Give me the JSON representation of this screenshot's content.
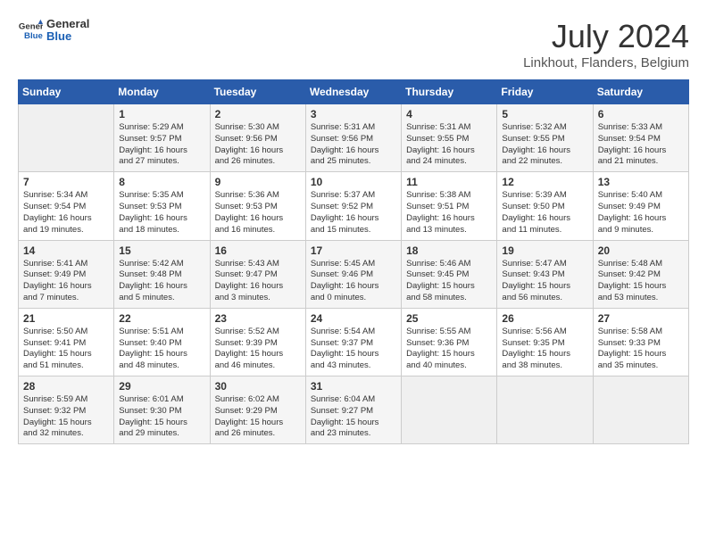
{
  "app": {
    "name_line1": "General",
    "name_line2": "Blue"
  },
  "title": "July 2024",
  "location": "Linkhout, Flanders, Belgium",
  "days_of_week": [
    "Sunday",
    "Monday",
    "Tuesday",
    "Wednesday",
    "Thursday",
    "Friday",
    "Saturday"
  ],
  "weeks": [
    [
      {
        "day": "",
        "info": ""
      },
      {
        "day": "1",
        "info": "Sunrise: 5:29 AM\nSunset: 9:57 PM\nDaylight: 16 hours\nand 27 minutes."
      },
      {
        "day": "2",
        "info": "Sunrise: 5:30 AM\nSunset: 9:56 PM\nDaylight: 16 hours\nand 26 minutes."
      },
      {
        "day": "3",
        "info": "Sunrise: 5:31 AM\nSunset: 9:56 PM\nDaylight: 16 hours\nand 25 minutes."
      },
      {
        "day": "4",
        "info": "Sunrise: 5:31 AM\nSunset: 9:55 PM\nDaylight: 16 hours\nand 24 minutes."
      },
      {
        "day": "5",
        "info": "Sunrise: 5:32 AM\nSunset: 9:55 PM\nDaylight: 16 hours\nand 22 minutes."
      },
      {
        "day": "6",
        "info": "Sunrise: 5:33 AM\nSunset: 9:54 PM\nDaylight: 16 hours\nand 21 minutes."
      }
    ],
    [
      {
        "day": "7",
        "info": "Sunrise: 5:34 AM\nSunset: 9:54 PM\nDaylight: 16 hours\nand 19 minutes."
      },
      {
        "day": "8",
        "info": "Sunrise: 5:35 AM\nSunset: 9:53 PM\nDaylight: 16 hours\nand 18 minutes."
      },
      {
        "day": "9",
        "info": "Sunrise: 5:36 AM\nSunset: 9:53 PM\nDaylight: 16 hours\nand 16 minutes."
      },
      {
        "day": "10",
        "info": "Sunrise: 5:37 AM\nSunset: 9:52 PM\nDaylight: 16 hours\nand 15 minutes."
      },
      {
        "day": "11",
        "info": "Sunrise: 5:38 AM\nSunset: 9:51 PM\nDaylight: 16 hours\nand 13 minutes."
      },
      {
        "day": "12",
        "info": "Sunrise: 5:39 AM\nSunset: 9:50 PM\nDaylight: 16 hours\nand 11 minutes."
      },
      {
        "day": "13",
        "info": "Sunrise: 5:40 AM\nSunset: 9:49 PM\nDaylight: 16 hours\nand 9 minutes."
      }
    ],
    [
      {
        "day": "14",
        "info": "Sunrise: 5:41 AM\nSunset: 9:49 PM\nDaylight: 16 hours\nand 7 minutes."
      },
      {
        "day": "15",
        "info": "Sunrise: 5:42 AM\nSunset: 9:48 PM\nDaylight: 16 hours\nand 5 minutes."
      },
      {
        "day": "16",
        "info": "Sunrise: 5:43 AM\nSunset: 9:47 PM\nDaylight: 16 hours\nand 3 minutes."
      },
      {
        "day": "17",
        "info": "Sunrise: 5:45 AM\nSunset: 9:46 PM\nDaylight: 16 hours\nand 0 minutes."
      },
      {
        "day": "18",
        "info": "Sunrise: 5:46 AM\nSunset: 9:45 PM\nDaylight: 15 hours\nand 58 minutes."
      },
      {
        "day": "19",
        "info": "Sunrise: 5:47 AM\nSunset: 9:43 PM\nDaylight: 15 hours\nand 56 minutes."
      },
      {
        "day": "20",
        "info": "Sunrise: 5:48 AM\nSunset: 9:42 PM\nDaylight: 15 hours\nand 53 minutes."
      }
    ],
    [
      {
        "day": "21",
        "info": "Sunrise: 5:50 AM\nSunset: 9:41 PM\nDaylight: 15 hours\nand 51 minutes."
      },
      {
        "day": "22",
        "info": "Sunrise: 5:51 AM\nSunset: 9:40 PM\nDaylight: 15 hours\nand 48 minutes."
      },
      {
        "day": "23",
        "info": "Sunrise: 5:52 AM\nSunset: 9:39 PM\nDaylight: 15 hours\nand 46 minutes."
      },
      {
        "day": "24",
        "info": "Sunrise: 5:54 AM\nSunset: 9:37 PM\nDaylight: 15 hours\nand 43 minutes."
      },
      {
        "day": "25",
        "info": "Sunrise: 5:55 AM\nSunset: 9:36 PM\nDaylight: 15 hours\nand 40 minutes."
      },
      {
        "day": "26",
        "info": "Sunrise: 5:56 AM\nSunset: 9:35 PM\nDaylight: 15 hours\nand 38 minutes."
      },
      {
        "day": "27",
        "info": "Sunrise: 5:58 AM\nSunset: 9:33 PM\nDaylight: 15 hours\nand 35 minutes."
      }
    ],
    [
      {
        "day": "28",
        "info": "Sunrise: 5:59 AM\nSunset: 9:32 PM\nDaylight: 15 hours\nand 32 minutes."
      },
      {
        "day": "29",
        "info": "Sunrise: 6:01 AM\nSunset: 9:30 PM\nDaylight: 15 hours\nand 29 minutes."
      },
      {
        "day": "30",
        "info": "Sunrise: 6:02 AM\nSunset: 9:29 PM\nDaylight: 15 hours\nand 26 minutes."
      },
      {
        "day": "31",
        "info": "Sunrise: 6:04 AM\nSunset: 9:27 PM\nDaylight: 15 hours\nand 23 minutes."
      },
      {
        "day": "",
        "info": ""
      },
      {
        "day": "",
        "info": ""
      },
      {
        "day": "",
        "info": ""
      }
    ]
  ]
}
